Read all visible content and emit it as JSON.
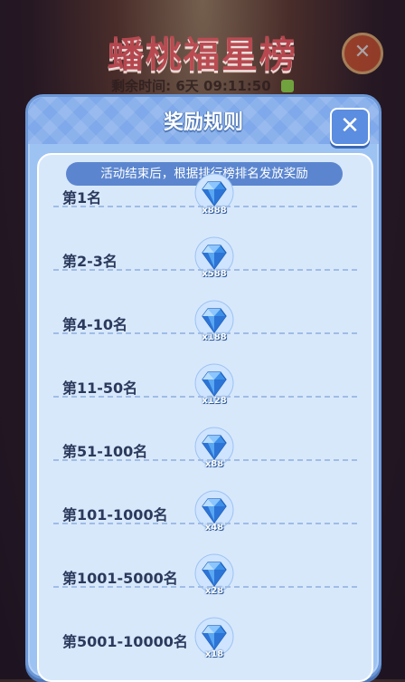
{
  "background": {
    "event_title": "蟠桃福星榜",
    "timer_label": "剩余时间:",
    "timer_value": "6天 09:11:50",
    "close_label": "✕"
  },
  "modal": {
    "title": "奖励规则",
    "close_label": "✕",
    "subtitle": "活动结束后，根据排行榜排名发放奖励"
  },
  "rewards": [
    {
      "rank": "第1名",
      "qty": "x888"
    },
    {
      "rank": "第2-3名",
      "qty": "x588"
    },
    {
      "rank": "第4-10名",
      "qty": "x188"
    },
    {
      "rank": "第11-50名",
      "qty": "x128"
    },
    {
      "rank": "第51-100名",
      "qty": "x88"
    },
    {
      "rank": "第101-1000名",
      "qty": "x48"
    },
    {
      "rank": "第1001-5000名",
      "qty": "x28"
    },
    {
      "rank": "第5001-10000名",
      "qty": "x18"
    }
  ],
  "colors": {
    "modal_bg": "#9dc3f3",
    "panel_bg": "#d8e8fb",
    "subtitle_bg": "#5b86cf",
    "rank_text": "#2b3a5c"
  },
  "icons": {
    "reward": "diamond-icon",
    "close": "close-icon"
  }
}
